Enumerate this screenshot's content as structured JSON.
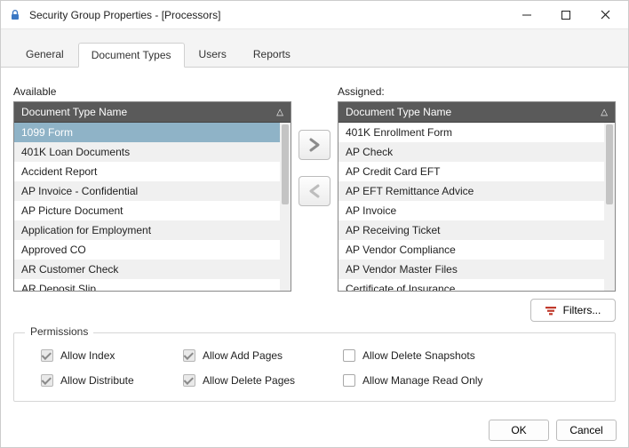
{
  "window": {
    "title": "Security Group Properties - [Processors]"
  },
  "tabs": [
    "General",
    "Document Types",
    "Users",
    "Reports"
  ],
  "activeTab": 1,
  "available": {
    "label": "Available",
    "column": "Document Type Name",
    "items": [
      "1099 Form",
      "401K Loan Documents",
      "Accident Report",
      "AP Invoice - Confidential",
      "AP Picture Document",
      "Application for Employment",
      "Approved CO",
      "AR Customer Check",
      "AR Deposit Slip"
    ],
    "selectedIndex": 0
  },
  "assigned": {
    "label": "Assigned:",
    "column": "Document Type Name",
    "items": [
      "401K Enrollment Form",
      "AP Check",
      "AP Credit Card EFT",
      "AP EFT Remittance Advice",
      "AP Invoice",
      "AP Receiving Ticket",
      "AP Vendor Compliance",
      "AP Vendor Master Files",
      "Certificate of Insurance"
    ]
  },
  "filtersLabel": "Filters...",
  "permissions": {
    "legend": "Permissions",
    "items": [
      {
        "label": "Allow Index",
        "state": "checked-gray"
      },
      {
        "label": "Allow Add Pages",
        "state": "checked-gray"
      },
      {
        "label": "Allow Delete Snapshots",
        "state": "unchecked"
      },
      {
        "label": "Allow Distribute",
        "state": "checked-gray"
      },
      {
        "label": "Allow Delete Pages",
        "state": "checked-gray"
      },
      {
        "label": "Allow Manage Read Only",
        "state": "unchecked"
      }
    ]
  },
  "buttons": {
    "ok": "OK",
    "cancel": "Cancel"
  }
}
